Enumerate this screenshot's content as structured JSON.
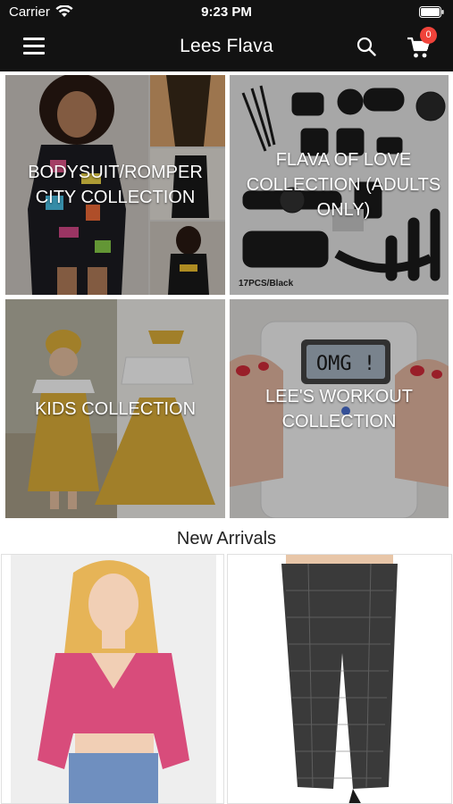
{
  "status_bar": {
    "carrier": "Carrier",
    "time": "9:23 PM"
  },
  "nav": {
    "title": "Lees Flava",
    "cart_count": "0"
  },
  "categories": [
    {
      "label": "BODYSUIT/ROMPER\nCITY COLLECTION"
    },
    {
      "label": "FLAVA OF LOVE\nCOLLECTION (ADULTS\nONLY)",
      "image_caption": "17PCS/Black"
    },
    {
      "label": "KIDS COLLECTION"
    },
    {
      "label": "LEE'S WORKOUT\nCOLLECTION",
      "scale_text": "OMG !"
    }
  ],
  "new_arrivals": {
    "title": "New Arrivals"
  },
  "colors": {
    "header_bg": "#121212",
    "badge": "#f0433a"
  }
}
